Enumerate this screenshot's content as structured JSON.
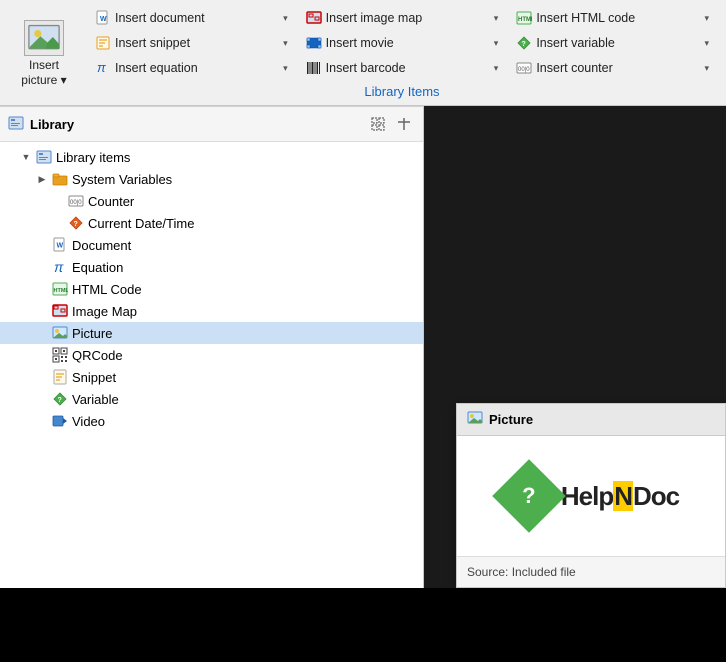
{
  "toolbar": {
    "insert_picture_label": "Insert\npicture",
    "insert_picture_line1": "Insert",
    "insert_picture_line2": "picture",
    "library_items_label": "Library Items",
    "buttons": [
      {
        "id": "insert-document",
        "label": "Insert document",
        "icon": "doc-icon",
        "has_arrow": true
      },
      {
        "id": "insert-image-map",
        "label": "Insert image map",
        "icon": "imagemap-icon",
        "has_arrow": true
      },
      {
        "id": "insert-html-code",
        "label": "Insert HTML code",
        "icon": "html-icon",
        "has_arrow": true
      },
      {
        "id": "insert-snippet",
        "label": "Insert snippet",
        "icon": "snippet-icon",
        "has_arrow": true
      },
      {
        "id": "insert-movie",
        "label": "Insert movie",
        "icon": "movie-icon",
        "has_arrow": true
      },
      {
        "id": "insert-variable",
        "label": "Insert variable",
        "icon": "variable-icon",
        "has_arrow": true
      },
      {
        "id": "insert-equation",
        "label": "Insert equation",
        "icon": "equation-icon",
        "has_arrow": true
      },
      {
        "id": "insert-barcode",
        "label": "Insert barcode",
        "icon": "barcode-icon",
        "has_arrow": true
      },
      {
        "id": "insert-counter",
        "label": "Insert counter",
        "icon": "counter-icon",
        "has_arrow": true
      }
    ]
  },
  "library": {
    "title": "Library",
    "items": [
      {
        "id": "library-items",
        "label": "Library items",
        "level": 1,
        "has_arrow": true,
        "expanded": true,
        "icon": "library-icon"
      },
      {
        "id": "system-variables",
        "label": "System Variables",
        "level": 2,
        "has_arrow": true,
        "expanded": false,
        "icon": "folder-icon"
      },
      {
        "id": "counter",
        "label": "Counter",
        "level": 3,
        "has_arrow": false,
        "icon": "counter-icon"
      },
      {
        "id": "current-datetime",
        "label": "Current Date/Time",
        "level": 3,
        "has_arrow": false,
        "icon": "datetime-icon"
      },
      {
        "id": "document",
        "label": "Document",
        "level": 2,
        "has_arrow": false,
        "icon": "doc-icon"
      },
      {
        "id": "equation",
        "label": "Equation",
        "level": 2,
        "has_arrow": false,
        "icon": "equation-icon"
      },
      {
        "id": "html-code",
        "label": "HTML Code",
        "level": 2,
        "has_arrow": false,
        "icon": "html-icon"
      },
      {
        "id": "image-map",
        "label": "Image Map",
        "level": 2,
        "has_arrow": false,
        "icon": "imagemap-icon"
      },
      {
        "id": "picture",
        "label": "Picture",
        "level": 2,
        "has_arrow": false,
        "icon": "picture-icon",
        "selected": true
      },
      {
        "id": "qrcode",
        "label": "QRCode",
        "level": 2,
        "has_arrow": false,
        "icon": "qrcode-icon"
      },
      {
        "id": "snippet",
        "label": "Snippet",
        "level": 2,
        "has_arrow": false,
        "icon": "snippet-icon"
      },
      {
        "id": "variable",
        "label": "Variable",
        "level": 2,
        "has_arrow": false,
        "icon": "variable-icon"
      },
      {
        "id": "video",
        "label": "Video",
        "level": 2,
        "has_arrow": false,
        "icon": "video-icon"
      }
    ]
  },
  "preview": {
    "title": "Picture",
    "logo_question": "?",
    "logo_text_part1": "Help",
    "logo_text_N": "N",
    "logo_text_part2": "Doc",
    "source_label": "Source: Included file"
  }
}
